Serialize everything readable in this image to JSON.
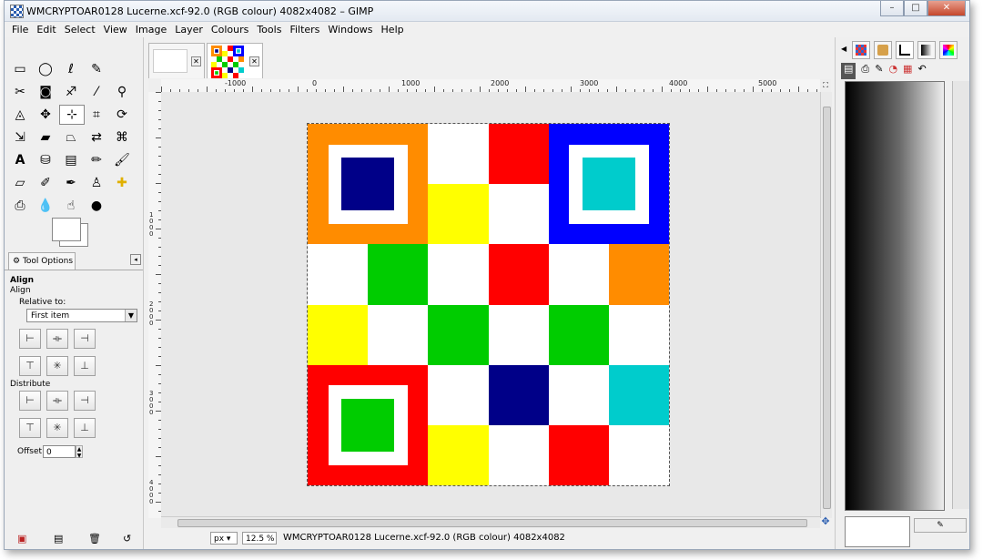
{
  "window": {
    "title": "WMCRYPTOAR0128 Lucerne.xcf-92.0 (RGB colour) 4082x4082 – GIMP"
  },
  "menu": [
    "File",
    "Edit",
    "Select",
    "View",
    "Image",
    "Layer",
    "Colours",
    "Tools",
    "Filters",
    "Windows",
    "Help"
  ],
  "tool_options": {
    "tab_label": "Tool Options",
    "heading": "Align",
    "subheading": "Align",
    "relative_to_label": "Relative to:",
    "relative_to_value": "First item",
    "distribute_label": "Distribute",
    "offset_label": "Offset:",
    "offset_value": "0"
  },
  "ruler_labels": [
    "-1000",
    "0",
    "1000",
    "2000",
    "3000",
    "4000",
    "5000"
  ],
  "vruler_labels": [
    "1000",
    "2000",
    "3000",
    "4000"
  ],
  "status": {
    "unit": "px",
    "zoom": "12.5 %",
    "text": "WMCRYPTOAR0128 Lucerne.xcf-92.0 (RGB colour) 4082x4082"
  },
  "colors": {
    "orange": "#ff8c00",
    "navy": "#000088",
    "blue": "#0000ff",
    "cyan": "#00cccc",
    "red": "#ff0000",
    "green": "#00cc00",
    "yellow": "#ffff00",
    "white": "#ffffff"
  },
  "image_grid": [
    [
      "orange-big",
      "orange-big",
      "white",
      "red",
      "blue-big",
      "blue-big"
    ],
    [
      "orange-big",
      "orange-big",
      "yellow",
      "white",
      "blue-big",
      "blue-big"
    ],
    [
      "white",
      "green",
      "white",
      "red",
      "white",
      "orange"
    ],
    [
      "yellow",
      "white",
      "green",
      "white",
      "green",
      "white"
    ],
    [
      "red-big",
      "red-big",
      "white",
      "navy",
      "white",
      "cyan"
    ],
    [
      "red-big",
      "red-big",
      "yellow",
      "white",
      "red",
      "white"
    ]
  ]
}
